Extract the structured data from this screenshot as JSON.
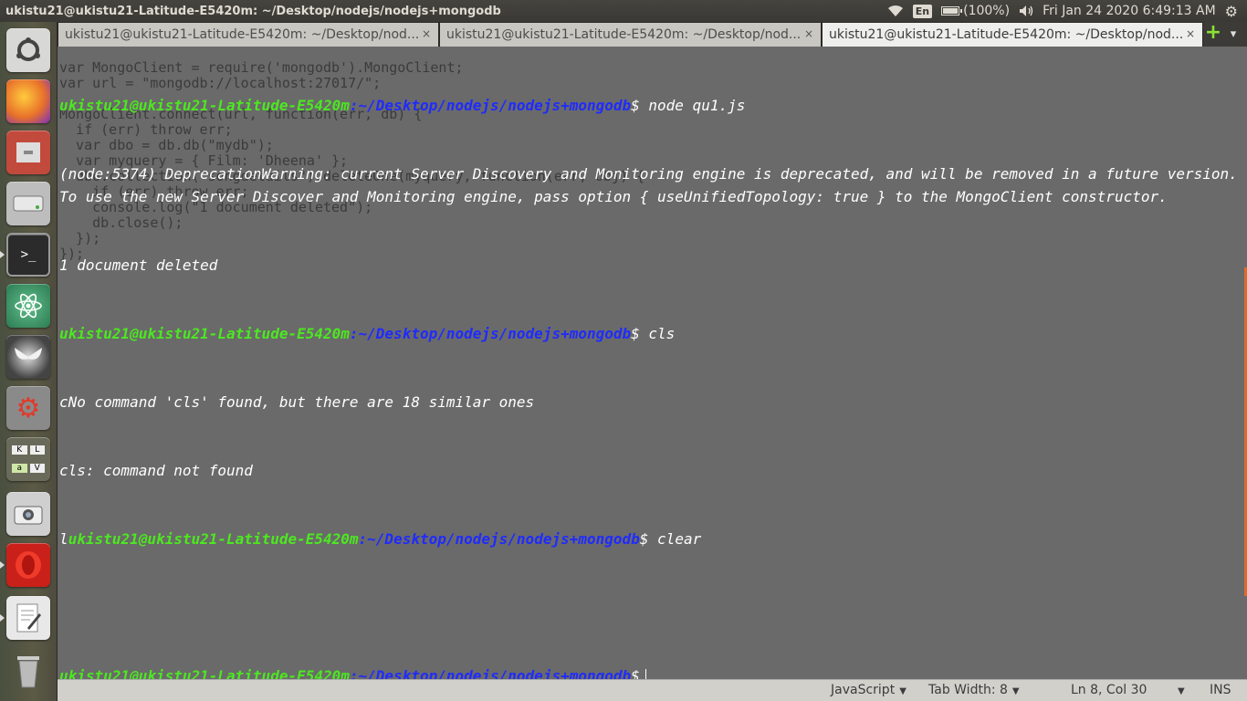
{
  "top_panel": {
    "window_title": "ukistu21@ukistu21-Latitude-E5420m: ~/Desktop/nodejs/nodejs+mongodb",
    "keyboard_lang": "En",
    "battery": "(100%)",
    "clock": "Fri Jan 24 2020  6:49:13 AM",
    "icons": [
      "wifi-icon",
      "battery-icon",
      "volume-icon",
      "gear-icon"
    ]
  },
  "launcher": {
    "items": [
      {
        "name": "ubuntu-dash-icon",
        "color": "#e0e0e0"
      },
      {
        "name": "firefox-icon",
        "color": "#e8712a"
      },
      {
        "name": "files-icon",
        "color": "#c24a3d"
      },
      {
        "name": "disk-icon",
        "color": "#bdbdbd"
      },
      {
        "name": "terminal-icon",
        "color": "#2b2b2b"
      },
      {
        "name": "atom-icon",
        "color": "#3d9a6a"
      },
      {
        "name": "moth-icon",
        "color": "#5a5a5a"
      },
      {
        "name": "system-settings-icon",
        "color": "#8a8a8a"
      },
      {
        "name": "keyboard-icon",
        "color": "#d8d8d8"
      },
      {
        "name": "camera-icon",
        "color": "#cfcfcf"
      },
      {
        "name": "opera-icon",
        "color": "#d7261f"
      },
      {
        "name": "text-editor-icon",
        "color": "#e8e8e8"
      },
      {
        "name": "trash-icon",
        "color": "#bbbbbb"
      }
    ]
  },
  "tabs": [
    {
      "label": "ukistu21@ukistu21-Latitude-E5420m: ~/Desktop/nod...",
      "close": "×"
    },
    {
      "label": "ukistu21@ukistu21-Latitude-E5420m: ~/Desktop/nod...",
      "close": "×"
    },
    {
      "label": "ukistu21@ukistu21-Latitude-E5420m: ~/Desktop/nod...",
      "close": "×"
    }
  ],
  "tab_add": "+",
  "tab_menu": "▾",
  "terminal": {
    "user": "ukistu21@ukistu21-Latitude-E5420m",
    "path": ":~/Desktop/nodejs/nodejs+mongodb",
    "lines": {
      "cmd1": "$ node qu1.js",
      "warn": "(node:5374) DeprecationWarning: current Server Discovery and Monitoring engine is deprecated, and will be removed in a future version. To use the new Server Discover and Monitoring engine, pass option { useUnifiedTopology: true } to the MongoClient constructor.",
      "deleted": "1 document deleted",
      "cmd2": "$ cls",
      "notfound": "cNo command 'cls' found, but there are 18 similar ones",
      "err": "cls: command not found",
      "prefix": "l",
      "cmd3": "$ clear",
      "prompt_end": "$"
    },
    "ghost_code": [
      "var MongoClient = require('mongodb').MongoClient;",
      "var url = \"mongodb://localhost:27017/\";",
      "",
      "MongoClient.connect(url, function(err, db) {",
      "  if (err) throw err;",
      "  var dbo = db.db(\"mydb\");",
      "  var myquery = { Film: 'Dheena' };",
      "  dbo.collection(\"songdetails\").deleteOne(myquery, function(err, obj) {",
      "    if (err) throw err;",
      "    console.log(\"1 document deleted\");",
      "    db.close();",
      "  });",
      "});"
    ]
  },
  "statusbar": {
    "language": "JavaScript",
    "tab_width": "Tab Width: 8",
    "position": "Ln 8, Col 30",
    "mode": "INS"
  }
}
